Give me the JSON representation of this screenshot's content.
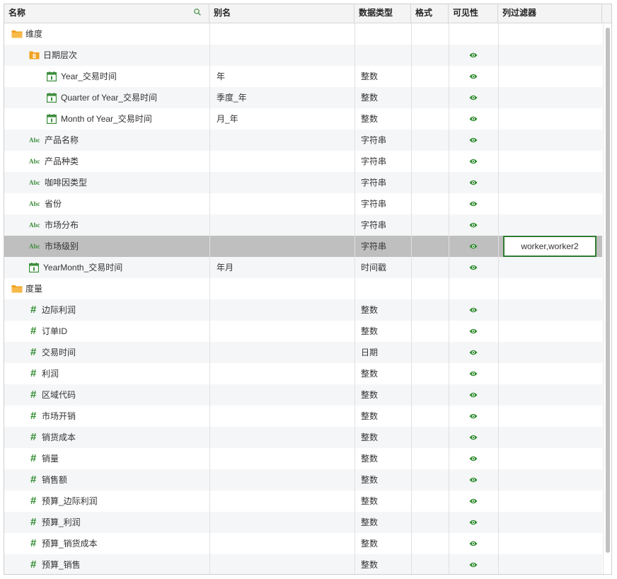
{
  "columns": {
    "name": "名称",
    "alias": "别名",
    "data_type": "数据类型",
    "format": "格式",
    "visibility": "可见性",
    "column_filter": "列过滤器"
  },
  "icons": {
    "folder": "folder-icon",
    "date_hierarchy": "date-hierarchy-icon",
    "calendar": "calendar-icon",
    "text": "abc-text-icon",
    "number": "hash-icon",
    "visible": "eye-icon",
    "search": "search-icon"
  },
  "colors": {
    "accent_green": "#2f7d32",
    "folder_orange": "#f5a623",
    "selected_row": "#bfbfbf"
  },
  "abc_text": "Abc",
  "hash_text": "#",
  "rows": [
    {
      "name": "维度",
      "alias": "",
      "type": "",
      "kind": "folder",
      "level": 0,
      "visible": false
    },
    {
      "name": "日期层次",
      "alias": "",
      "type": "",
      "kind": "date_hierarchy",
      "level": 1,
      "visible": true
    },
    {
      "name": "Year_交易时间",
      "alias": "年",
      "type": "整数",
      "kind": "calendar",
      "level": 2,
      "visible": true
    },
    {
      "name": "Quarter of Year_交易时间",
      "alias": "季度_年",
      "type": "整数",
      "kind": "calendar",
      "level": 2,
      "visible": true
    },
    {
      "name": "Month of Year_交易时间",
      "alias": "月_年",
      "type": "整数",
      "kind": "calendar",
      "level": 2,
      "visible": true
    },
    {
      "name": "产品名称",
      "alias": "",
      "type": "字符串",
      "kind": "text",
      "level": 1,
      "visible": true
    },
    {
      "name": "产品种类",
      "alias": "",
      "type": "字符串",
      "kind": "text",
      "level": 1,
      "visible": true
    },
    {
      "name": "咖啡因类型",
      "alias": "",
      "type": "字符串",
      "kind": "text",
      "level": 1,
      "visible": true
    },
    {
      "name": "省份",
      "alias": "",
      "type": "字符串",
      "kind": "text",
      "level": 1,
      "visible": true
    },
    {
      "name": "市场分布",
      "alias": "",
      "type": "字符串",
      "kind": "text",
      "level": 1,
      "visible": true
    },
    {
      "name": "市场级别",
      "alias": "",
      "type": "字符串",
      "kind": "text",
      "level": 1,
      "visible": true,
      "selected": true,
      "filter": "worker,worker2"
    },
    {
      "name": "YearMonth_交易时间",
      "alias": "年月",
      "type": "时间戳",
      "kind": "calendar",
      "level": 1,
      "visible": true
    },
    {
      "name": "度量",
      "alias": "",
      "type": "",
      "kind": "folder",
      "level": 0,
      "visible": false
    },
    {
      "name": "边际利润",
      "alias": "",
      "type": "整数",
      "kind": "number",
      "level": 1,
      "visible": true
    },
    {
      "name": "订单ID",
      "alias": "",
      "type": "整数",
      "kind": "number",
      "level": 1,
      "visible": true
    },
    {
      "name": "交易时间",
      "alias": "",
      "type": "日期",
      "kind": "number",
      "level": 1,
      "visible": true
    },
    {
      "name": "利润",
      "alias": "",
      "type": "整数",
      "kind": "number",
      "level": 1,
      "visible": true
    },
    {
      "name": "区域代码",
      "alias": "",
      "type": "整数",
      "kind": "number",
      "level": 1,
      "visible": true
    },
    {
      "name": "市场开销",
      "alias": "",
      "type": "整数",
      "kind": "number",
      "level": 1,
      "visible": true
    },
    {
      "name": "销货成本",
      "alias": "",
      "type": "整数",
      "kind": "number",
      "level": 1,
      "visible": true
    },
    {
      "name": "销量",
      "alias": "",
      "type": "整数",
      "kind": "number",
      "level": 1,
      "visible": true
    },
    {
      "name": "销售额",
      "alias": "",
      "type": "整数",
      "kind": "number",
      "level": 1,
      "visible": true
    },
    {
      "name": "预算_边际利润",
      "alias": "",
      "type": "整数",
      "kind": "number",
      "level": 1,
      "visible": true
    },
    {
      "name": "预算_利润",
      "alias": "",
      "type": "整数",
      "kind": "number",
      "level": 1,
      "visible": true
    },
    {
      "name": "预算_销货成本",
      "alias": "",
      "type": "整数",
      "kind": "number",
      "level": 1,
      "visible": true
    },
    {
      "name": "预算_销售",
      "alias": "",
      "type": "整数",
      "kind": "number",
      "level": 1,
      "visible": true
    }
  ]
}
